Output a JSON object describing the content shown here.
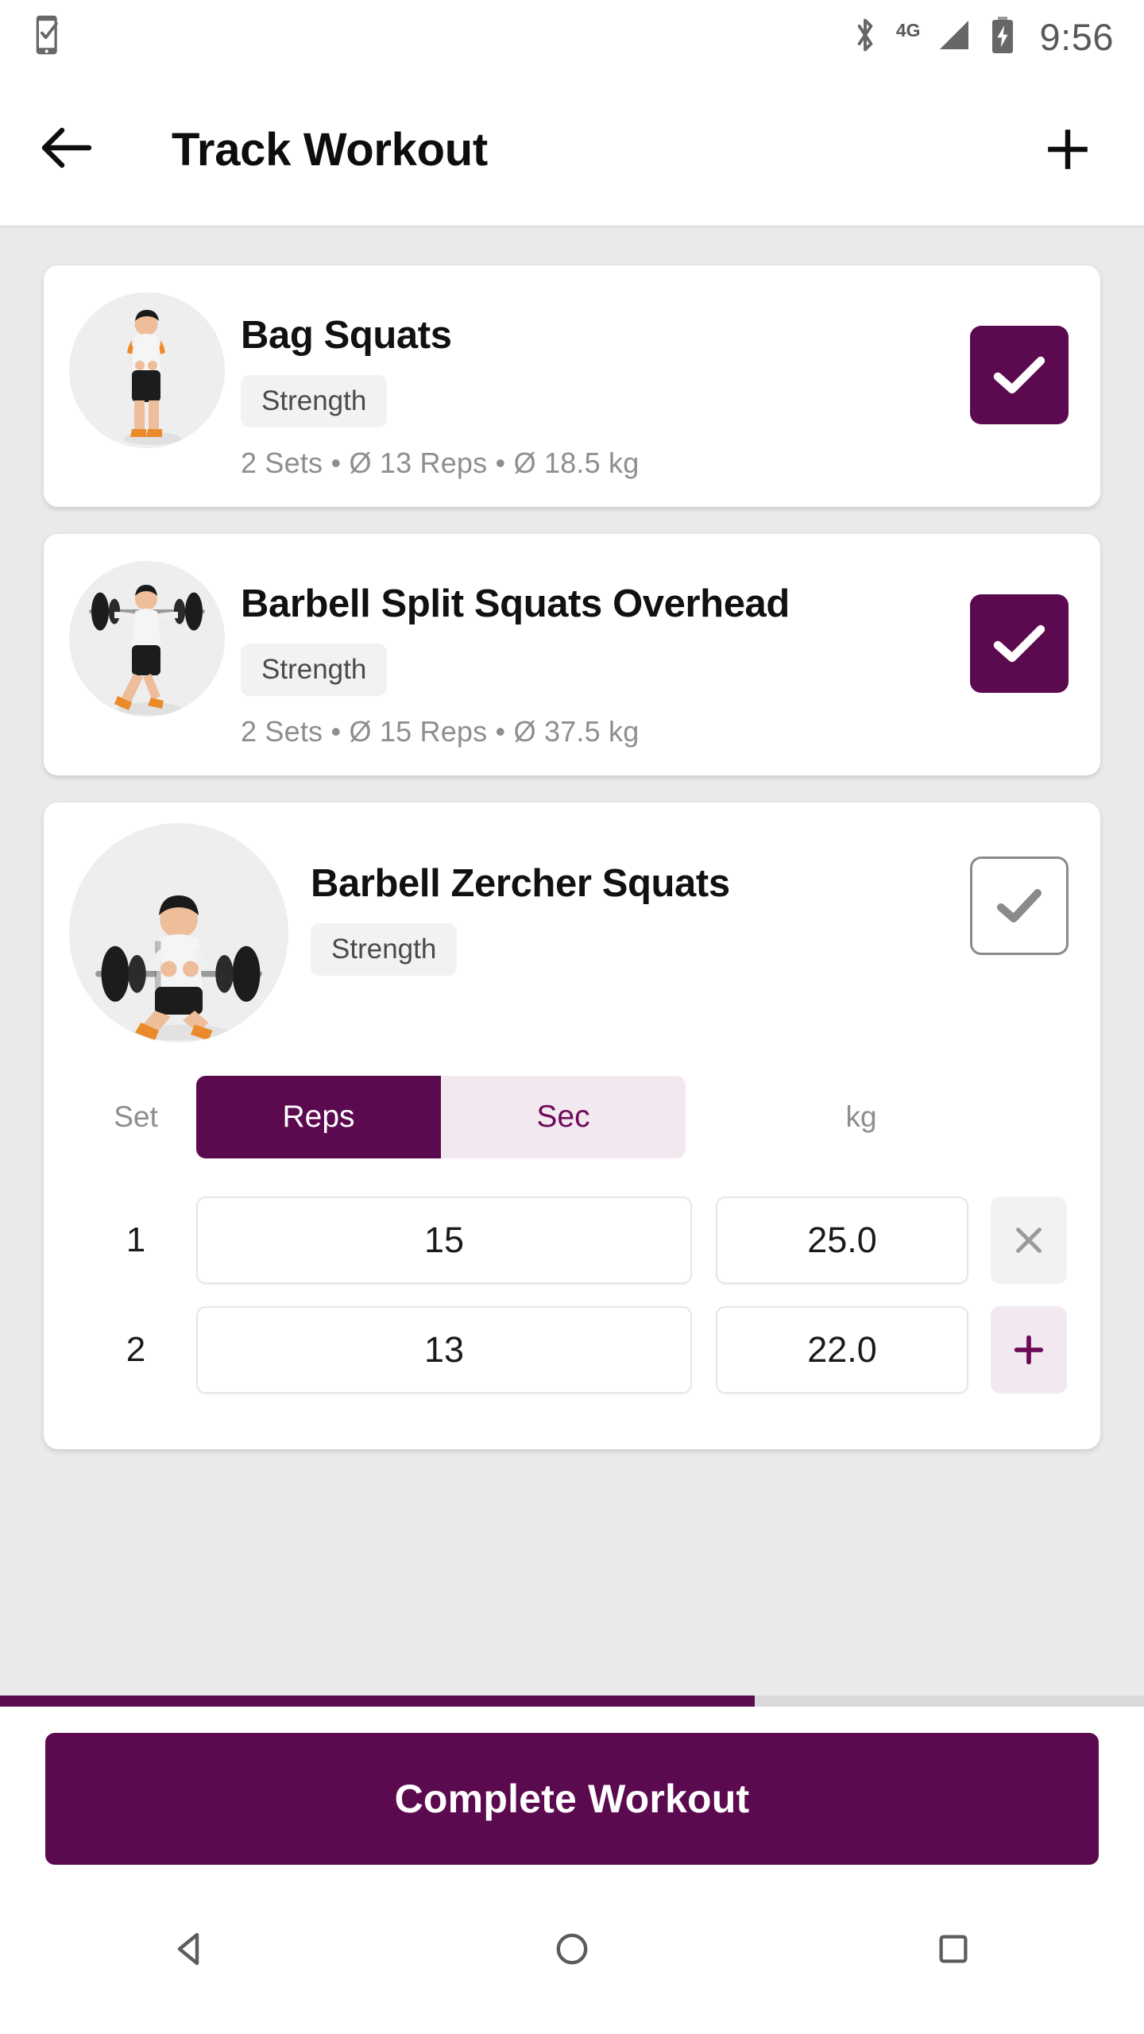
{
  "status_bar": {
    "notification_icon": "phone-check-icon",
    "bluetooth_icon": "bluetooth-icon",
    "network_label": "4G",
    "signal_icon": "signal-icon",
    "battery_icon": "battery-charging-icon",
    "time": "9:56"
  },
  "app_bar": {
    "back_icon": "arrow-left-icon",
    "title": "Track Workout",
    "add_icon": "plus-icon"
  },
  "colors": {
    "accent": "#5C0A4F",
    "accent_light": "#F2E9F0",
    "page_background": "#EAEAEA",
    "card_background": "#FFFFFF",
    "muted_text": "#8E8E8E"
  },
  "exercises": [
    {
      "name": "Bag Squats",
      "category": "Strength",
      "summary": "2 Sets  •  Ø 13 Reps  •  Ø 18.5 kg",
      "sets_text": "2 Sets",
      "avg_reps_text": "Ø 13 Reps",
      "avg_weight_text": "Ø 18.5 kg",
      "completed": true,
      "expanded": false,
      "thumb_icon": "athlete-bag-squat-icon"
    },
    {
      "name": "Barbell Split Squats Overhead",
      "category": "Strength",
      "summary": "2 Sets  •  Ø 15 Reps  •  Ø 37.5 kg",
      "sets_text": "2 Sets",
      "avg_reps_text": "Ø 15 Reps",
      "avg_weight_text": "Ø 37.5 kg",
      "completed": true,
      "expanded": false,
      "thumb_icon": "athlete-barbell-overhead-icon"
    },
    {
      "name": "Barbell Zercher Squats",
      "category": "Strength",
      "completed": false,
      "expanded": true,
      "thumb_icon": "athlete-zercher-squat-icon"
    }
  ],
  "set_table": {
    "set_header": "Set",
    "weight_header": "kg",
    "mode_toggle": {
      "active": "Reps",
      "inactive": "Sec"
    },
    "rows": [
      {
        "set": "1",
        "reps": "15",
        "weight": "25.0",
        "action": "delete",
        "action_icon": "close-icon"
      },
      {
        "set": "2",
        "reps": "13",
        "weight": "22.0",
        "action": "add",
        "action_icon": "plus-icon"
      }
    ]
  },
  "progress": {
    "percent": 66
  },
  "cta": {
    "label": "Complete Workout"
  },
  "nav_bar": {
    "back": "nav-back-icon",
    "home": "nav-home-icon",
    "recents": "nav-recents-icon"
  }
}
